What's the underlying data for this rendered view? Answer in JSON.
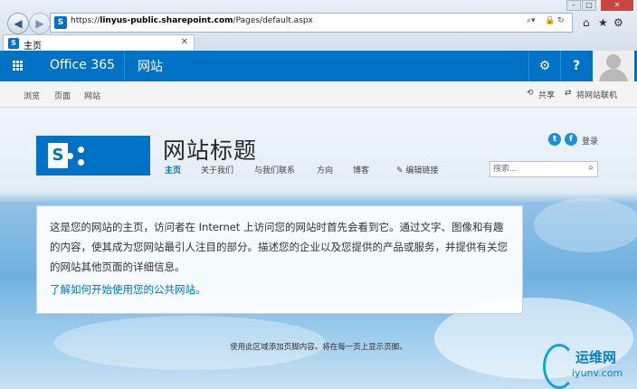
{
  "browser": {
    "url_prefix": "https://",
    "url_host": "linyus-public.sharepoint.com",
    "url_path": "/Pages/default.aspx",
    "tab_title": "主页",
    "favicon_letter": "S"
  },
  "suite_bar": {
    "app_name": "Office 365",
    "section": "网站",
    "help_label": "?",
    "accent": "#0072c6"
  },
  "ribbon": {
    "tabs": [
      "浏览",
      "页面",
      "网站"
    ],
    "share_label": "共享",
    "sync_label": "将网站联机"
  },
  "site": {
    "title": "网站标题",
    "logo_letter": "S",
    "nav": [
      "主页",
      "关于我们",
      "与我们联系",
      "方向",
      "博客"
    ],
    "edit_links_label": "编辑链接",
    "login_label": "登录",
    "search_placeholder": "搜索..."
  },
  "content": {
    "body": "这是您的网站的主页，访问者在 Internet 上访问您的网站时首先会看到它。通过文字、图像和有趣的内容，使其成为您网站最引人注目的部分。描述您的企业以及您提供的产品或服务，并提供有关您的网站其他页面的详细信息。",
    "link": "了解如何开始使用您的公共网站。"
  },
  "footer": {
    "text": "使用此区域添加页脚内容。将在每一页上显示页脚。"
  },
  "watermark": {
    "line1": "运维网",
    "line2": "iyunv.com"
  }
}
